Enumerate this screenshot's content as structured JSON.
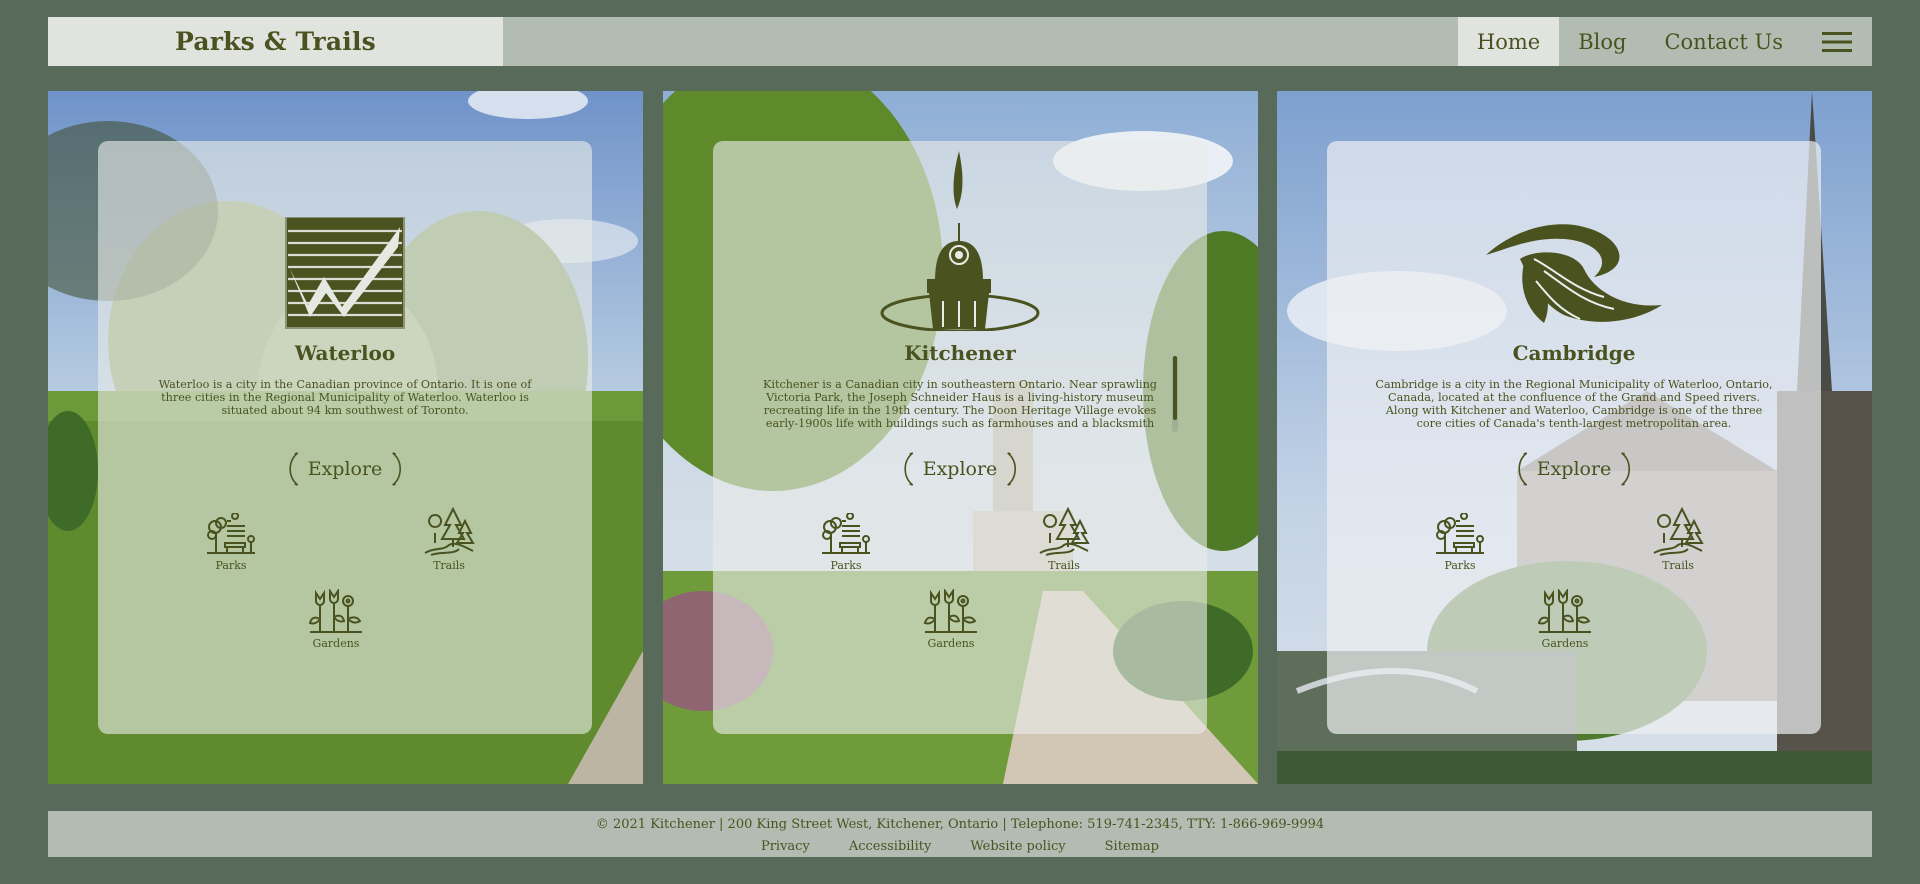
{
  "header": {
    "brand": "Parks & Trails",
    "nav": [
      {
        "label": "Home",
        "active": true
      },
      {
        "label": "Blog",
        "active": false
      },
      {
        "label": "Contact Us",
        "active": false
      }
    ],
    "menu_icon": "hamburger-menu-icon"
  },
  "cards": [
    {
      "title": "Waterloo",
      "description": "Waterloo is a city in the Canadian province of Ontario. It is one of three cities in the Regional Municipality of Waterloo. Waterloo is situated about 94 km southwest of Toronto.",
      "explore_label": "Explore",
      "logo_icon": "waterloo-logo-icon",
      "features": [
        {
          "label": "Parks",
          "icon": "park-bench-tree-icon"
        },
        {
          "label": "Trails",
          "icon": "trail-trees-icon"
        },
        {
          "label": "Gardens",
          "icon": "garden-flowers-icon"
        }
      ]
    },
    {
      "title": "Kitchener",
      "description": "Kitchener is a Canadian city in southeastern Ontario. Near sprawling Victoria Park, the Joseph Schneider Haus is a living-history museum recreating life in the 19th century. The Doon Heritage Village evokes early-1900s life with buildings such as farmhouses and a blacksmith",
      "explore_label": "Explore",
      "logo_icon": "kitchener-logo-icon",
      "features": [
        {
          "label": "Parks",
          "icon": "park-bench-tree-icon"
        },
        {
          "label": "Trails",
          "icon": "trail-trees-icon"
        },
        {
          "label": "Gardens",
          "icon": "garden-flowers-icon"
        }
      ]
    },
    {
      "title": "Cambridge",
      "description": "Cambridge is a city in the Regional Municipality of Waterloo, Ontario, Canada, located at the confluence of the Grand and Speed rivers. Along with Kitchener and Waterloo, Cambridge is one of the three core cities of Canada's tenth-largest metropolitan area.",
      "explore_label": "Explore",
      "logo_icon": "cambridge-logo-icon",
      "features": [
        {
          "label": "Parks",
          "icon": "park-bench-tree-icon"
        },
        {
          "label": "Trails",
          "icon": "trail-trees-icon"
        },
        {
          "label": "Gardens",
          "icon": "garden-flowers-icon"
        }
      ]
    }
  ],
  "footer": {
    "copyright": "© 2021 Kitchener | 200 King Street West, Kitchener, Ontario | Telephone: 519-741-2345, TTY: 1-866-969-9994",
    "links": [
      "Privacy",
      "Accessibility",
      "Website policy",
      "Sitemap"
    ]
  },
  "colors": {
    "background": "#586b5b",
    "header_bar": "#b3bcb2",
    "accent_text": "#4a5320"
  }
}
